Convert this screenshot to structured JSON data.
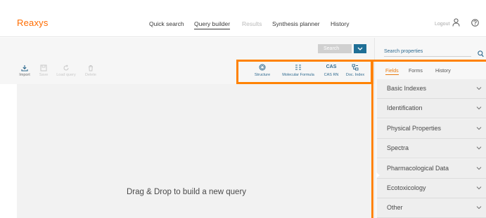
{
  "header": {
    "logo": "Reaxys",
    "nav": [
      {
        "label": "Quick search",
        "state": "normal"
      },
      {
        "label": "Query builder",
        "state": "active"
      },
      {
        "label": "Results",
        "state": "disabled"
      },
      {
        "label": "Synthesis planner",
        "state": "normal"
      },
      {
        "label": "History",
        "state": "normal"
      }
    ],
    "logout": "Logout",
    "user_icon": "user-icon",
    "help_icon": "help-icon"
  },
  "toolbar": {
    "search_label": "Search",
    "search_dropdown_icon": "chevron-down-icon",
    "actions": [
      {
        "label": "Import",
        "icon": "import-icon",
        "enabled": true
      },
      {
        "label": "Save",
        "icon": "save-icon",
        "enabled": false
      },
      {
        "label": "Load query",
        "icon": "reload-icon",
        "enabled": false
      },
      {
        "label": "Delete",
        "icon": "trash-icon",
        "enabled": false
      }
    ],
    "builders": [
      {
        "label": "Structure",
        "icon": "structure-icon"
      },
      {
        "label": "Molecular Formula",
        "icon": "formula-icon"
      },
      {
        "label": "CAS RN",
        "icon_text": "CAS"
      },
      {
        "label": "Doc. Index",
        "icon": "doc-index-icon"
      }
    ]
  },
  "canvas": {
    "drop_text": "Drag & Drop to build a new query"
  },
  "panel": {
    "search_placeholder": "Search properties",
    "tabs": [
      "Fields",
      "Forms",
      "History"
    ],
    "active_tab": "Fields",
    "sections": [
      "Basic Indexes",
      "Identification",
      "Physical Properties",
      "Spectra",
      "Pharmacological Data",
      "Ecotoxicology",
      "Other"
    ]
  },
  "colors": {
    "brand": "#ff6c00",
    "highlight": "#ff8200",
    "accent_blue": "#1f6f96",
    "link_blue": "#2f6a8f"
  }
}
